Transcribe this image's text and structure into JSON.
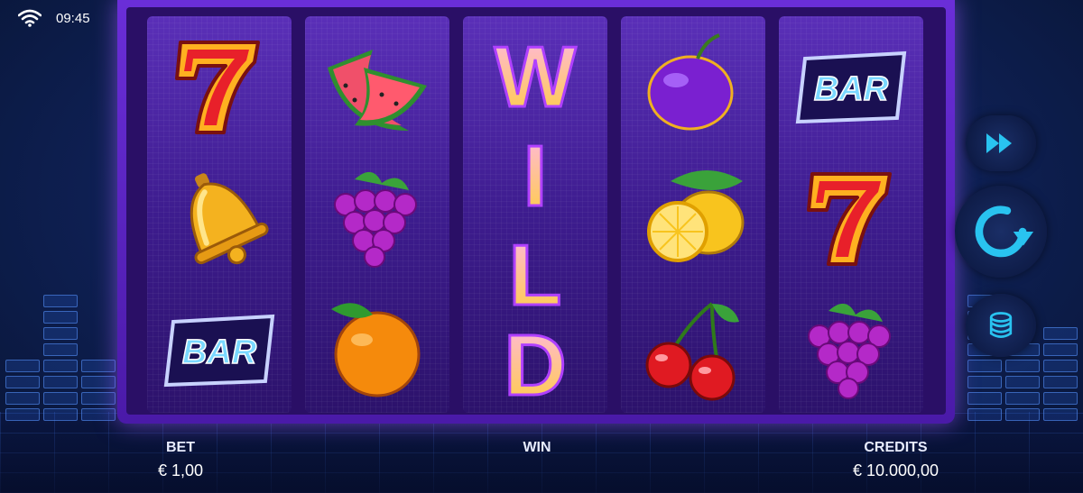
{
  "status_bar": {
    "time": "09:45",
    "wifi_icon": "wifi-icon"
  },
  "reels": [
    {
      "symbols": [
        "seven",
        "bell",
        "bar"
      ]
    },
    {
      "symbols": [
        "watermelon",
        "grapes",
        "orange"
      ]
    },
    {
      "symbols": [
        "wild"
      ]
    },
    {
      "symbols": [
        "plum",
        "lemon",
        "cherry"
      ]
    },
    {
      "symbols": [
        "bar",
        "seven",
        "grapes"
      ]
    }
  ],
  "symbol_text": {
    "bar": "BAR",
    "wild_letters": [
      "W",
      "I",
      "L",
      "D"
    ]
  },
  "footer": {
    "bet_label": "BET",
    "bet_value": "€ 1,00",
    "win_label": "WIN",
    "win_value": "",
    "credits_label": "CREDITS",
    "credits_value": "€ 10.000,00"
  },
  "controls": {
    "turbo_icon": "fast-forward-icon",
    "spin_icon": "spin-icon",
    "bet_icon": "coin-stack-icon"
  },
  "colors": {
    "accent": "#29c3f0",
    "cabinet": "#6a2ed8"
  }
}
